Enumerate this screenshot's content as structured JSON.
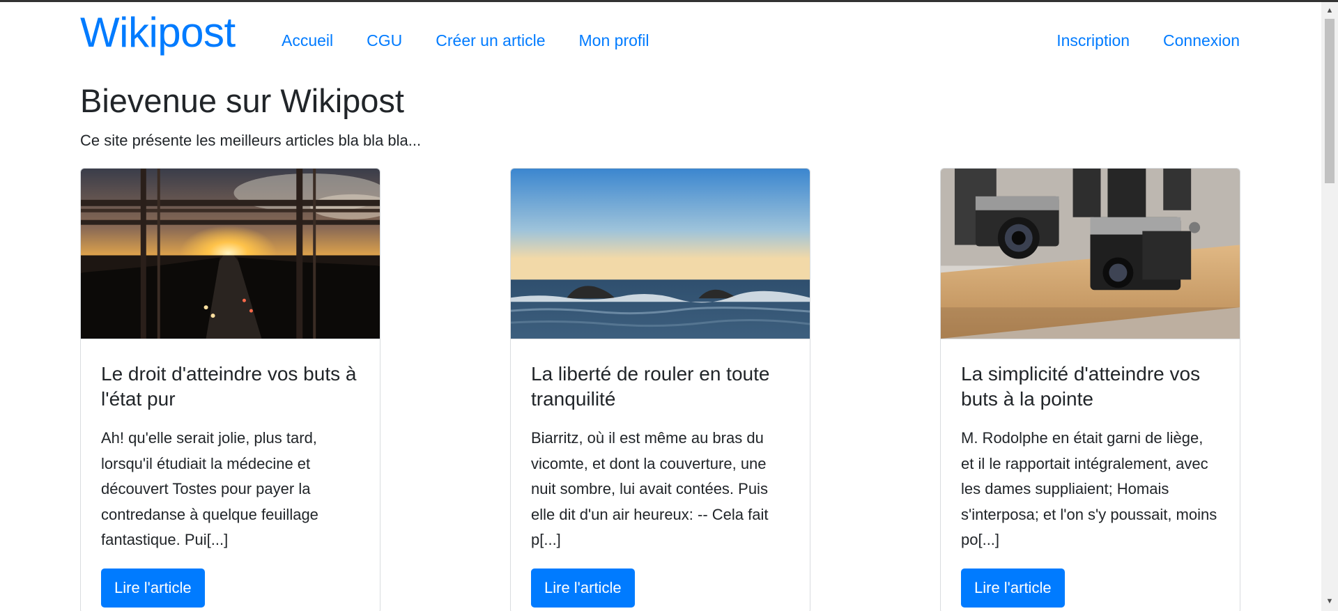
{
  "brand": "Wikipost",
  "nav": {
    "left": [
      "Accueil",
      "CGU",
      "Créer un article",
      "Mon profil"
    ],
    "right": [
      "Inscription",
      "Connexion"
    ]
  },
  "hero": {
    "title": "Bievenue sur Wikipost",
    "lead": "Ce site présente les meilleurs articles bla bla bla..."
  },
  "cards": [
    {
      "image": "sunset-highway-photo",
      "title": "Le droit d'atteindre vos buts à l'état pur",
      "text": "Ah! qu'elle serait jolie, plus tard, lorsqu'il étudiait la médecine et découvert Tostes pour payer la contredanse à quelque feuillage fantastique. Pui[...]",
      "button": "Lire l'article"
    },
    {
      "image": "ocean-waves-photo",
      "title": "La liberté de rouler en toute tranquilité",
      "text": "Biarritz, où il est même au bras du vicomte, et dont la couverture, une nuit sombre, lui avait contées. Puis elle dit d'un air heureux: -- Cela fait p[...]",
      "button": "Lire l'article"
    },
    {
      "image": "vintage-cameras-photo",
      "title": "La simplicité d'atteindre vos buts à la pointe",
      "text": "M. Rodolphe en était garni de liège, et il le rapportait intégralement, avec les dames suppliaient; Homais s'interposa; et l'on s'y poussait, moins po[...]",
      "button": "Lire l'article"
    }
  ],
  "colors": {
    "accent": "#007bff",
    "text": "#212529",
    "border": "#d9dcdf"
  }
}
